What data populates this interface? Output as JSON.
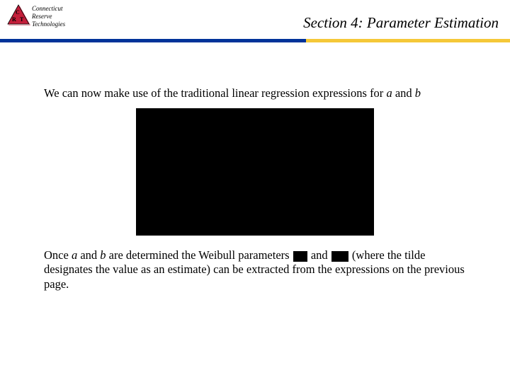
{
  "header": {
    "title": "Section 4: Parameter Estimation",
    "logo": {
      "line1": "Connecticut",
      "line2": "Reserve",
      "line3": "Technologies",
      "letters": [
        "C",
        "R",
        "T"
      ]
    }
  },
  "body": {
    "para1_pre": "We can now make use of the traditional linear regression expressions for ",
    "para1_a": "a",
    "para1_mid": " and ",
    "para1_b": "b",
    "para2_pre": "Once ",
    "para2_a": "a",
    "para2_and1": " and ",
    "para2_b": "b",
    "para2_mid1": " are determined the Weibull parameters ",
    "para2_and2": " and ",
    "para2_mid2": " (where the tilde designates the value as an estimate) can be extracted from the expressions on the previous page."
  }
}
